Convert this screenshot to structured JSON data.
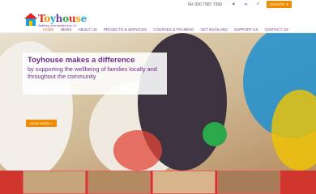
{
  "topbar": {
    "tel": "Tel: 020 7987 7390",
    "donate": "DONATE"
  },
  "logo": {
    "name": "Toyhouse",
    "tagline": "Wellbeing of the families from 0-5"
  },
  "nav": [
    "HOME",
    "NEWS",
    "ABOUT US",
    "PROJECTS & SERVICES",
    "COURSES & TRAINING",
    "GET INVOLVED",
    "SUPPORT US",
    "CONTACT US"
  ],
  "hero": {
    "title": "Toyhouse makes a difference",
    "subtitle": "by supporting the wellbeing of families locally and throughout the community",
    "cta": "READ MORE »"
  },
  "colors": {
    "purple": "#6a2c8c",
    "orange": "#f08a00",
    "red": "#d0362e"
  }
}
